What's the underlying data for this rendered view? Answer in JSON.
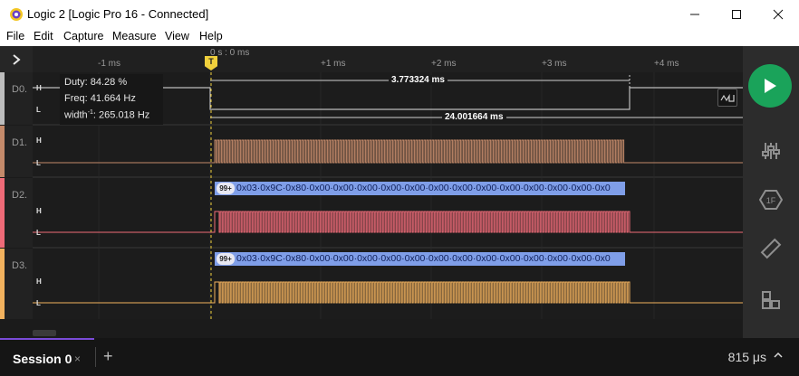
{
  "window": {
    "title": "Logic 2 [Logic Pro 16 - Connected]",
    "minimize_icon": "minimize-icon",
    "maximize_icon": "maximize-icon",
    "close_icon": "close-icon"
  },
  "menu": [
    "File",
    "Edit",
    "Capture",
    "Measure",
    "View",
    "Help"
  ],
  "ruler": {
    "zero_label": "0 s : 0 ms",
    "ticks": [
      "-1 ms",
      "+1 ms",
      "+2 ms",
      "+3 ms",
      "+4 ms"
    ],
    "marker_label": "T"
  },
  "channels": [
    {
      "name": "D0.",
      "color": "#bdbdbd",
      "high": "H",
      "low": "L"
    },
    {
      "name": "D1.",
      "color": "#c48a6a",
      "high": "H",
      "low": "L"
    },
    {
      "name": "D2.",
      "color": "#ef6b78",
      "high": "H",
      "low": "L"
    },
    {
      "name": "D3.",
      "color": "#f2b25e",
      "high": "H",
      "low": "L"
    }
  ],
  "measurement": {
    "duty": "Duty: 84.28 %",
    "freq": "Freq: 41.664 Hz",
    "width": "width",
    "width_sup": "-1",
    "width_value": ": 265.018 Hz",
    "span_high": "3.773324 ms",
    "span_total": "24.001664 ms"
  },
  "decode": {
    "badge": "99+",
    "text": "0x03·0x9C·0x80·0x00·0x00·0x00·0x00·0x00·0x00·0x00·0x00·0x00·0x00·0x00·0x00·0x0"
  },
  "sidebar": {
    "play_icon": "play-icon",
    "analyzers_icon": "sliders-icon",
    "extensions_icon": "hexagon-icon",
    "measure_icon": "ruler-icon",
    "layout_icon": "layout-icon"
  },
  "session": {
    "tab_label": "Session 0",
    "close": "×",
    "add": "+",
    "time": "815 μs"
  },
  "colors": {
    "accent_green": "#1aa35a",
    "session_accent": "#7a4bd8",
    "decode_bar": "#7f9ee8",
    "marker": "#f0d03c"
  }
}
